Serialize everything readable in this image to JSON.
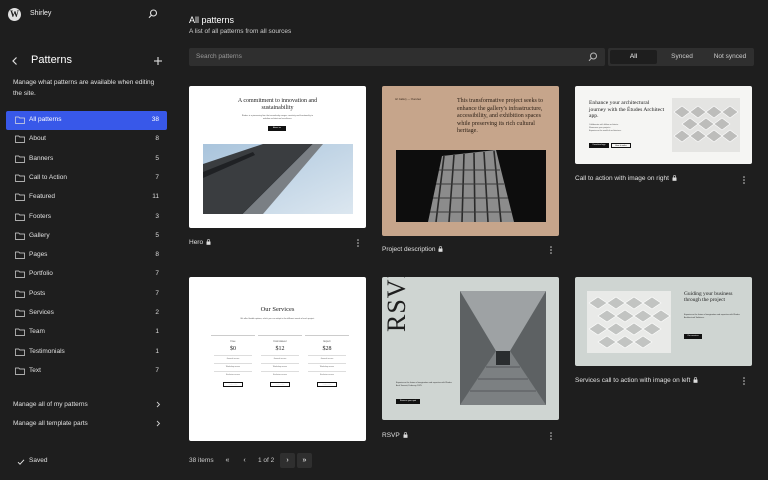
{
  "site": {
    "name": "Shirley"
  },
  "sidebar": {
    "title": "Patterns",
    "description": "Manage what patterns are available when editing the site.",
    "items": [
      {
        "label": "All patterns",
        "count": "38"
      },
      {
        "label": "About",
        "count": "8"
      },
      {
        "label": "Banners",
        "count": "5"
      },
      {
        "label": "Call to Action",
        "count": "7"
      },
      {
        "label": "Featured",
        "count": "11"
      },
      {
        "label": "Footers",
        "count": "3"
      },
      {
        "label": "Gallery",
        "count": "5"
      },
      {
        "label": "Pages",
        "count": "8"
      },
      {
        "label": "Portfolio",
        "count": "7"
      },
      {
        "label": "Posts",
        "count": "7"
      },
      {
        "label": "Services",
        "count": "2"
      },
      {
        "label": "Team",
        "count": "1"
      },
      {
        "label": "Testimonials",
        "count": "1"
      },
      {
        "label": "Text",
        "count": "7"
      }
    ],
    "manage_links": [
      {
        "label": "Manage all of my patterns"
      },
      {
        "label": "Manage all template parts"
      }
    ],
    "status": "Saved"
  },
  "main": {
    "title": "All patterns",
    "description": "A list of all patterns from all sources",
    "search_placeholder": "Search patterns",
    "filters": [
      {
        "label": "All",
        "active": true
      },
      {
        "label": "Synced",
        "active": false
      },
      {
        "label": "Not synced",
        "active": false
      }
    ],
    "cards": [
      {
        "name": "Hero"
      },
      {
        "name": "Project description"
      },
      {
        "name": "Call to action with image on right"
      },
      {
        "name": ""
      },
      {
        "name": "RSVP"
      },
      {
        "name": "Services call to action with image on left"
      }
    ],
    "previews": {
      "hero": {
        "heading": "A commitment to innovation and sustainability",
        "text": "Études is a pioneering firm that seamlessly merges creativity and functionality to redefine architectural excellence.",
        "button": "About us"
      },
      "project": {
        "meta": "Art Gallery — Overview",
        "text": "This transformative project seeks to enhance the gallery's infrastructure, accessibility, and exhibition spaces while preserving its rich cultural heritage."
      },
      "cta_right": {
        "heading": "Enhance your architectural journey with the Études Architect app.",
        "bullets": [
          "Collaborate with fellow architects.",
          "Showcase your projects.",
          "Experience the world of architecture."
        ],
        "buttons": [
          "Download app",
          "How it works"
        ]
      },
      "services": {
        "heading": "Our Services",
        "text": "We offer flexible options, which you can adapt to the different needs of each project.",
        "tiers": [
          {
            "name": "Free",
            "price": "$0"
          },
          {
            "name": "Connoisseur",
            "price": "$12"
          },
          {
            "name": "Expert",
            "price": "$28"
          }
        ],
        "features": [
          "General access",
          "Workshop access",
          "Exclusive access"
        ],
        "button": "Subscribe"
      },
      "rsvp": {
        "title": "RSVP",
        "text": "Experience the fusion of imagination and expertise with Études Arch Summit, February 2025.",
        "button": "Reserve your spot"
      },
      "services_cta": {
        "heading": "Guiding your business through the project",
        "text": "Experience the fusion of imagination and expertise with Études Architectural Solutions.",
        "button": "Our services"
      }
    },
    "pagination": {
      "total": "38 items",
      "first": "«",
      "prev": "‹",
      "page_label": "1 of 2",
      "next": "›",
      "last": "»"
    }
  },
  "colors": {
    "accent": "#3858e9",
    "bg": "#1e1e1e",
    "surface": "#2f2f2f",
    "project_bg": "#c6a58b",
    "cta_bg": "#f5f5f3",
    "rsvp_bg": "#cfd5d2"
  },
  "icons": [
    "wordpress-logo-icon",
    "search-icon",
    "chevron-left-icon",
    "plus-icon",
    "folder-icon",
    "chevron-right-icon",
    "check-icon",
    "lock-icon",
    "more-vertical-icon"
  ]
}
